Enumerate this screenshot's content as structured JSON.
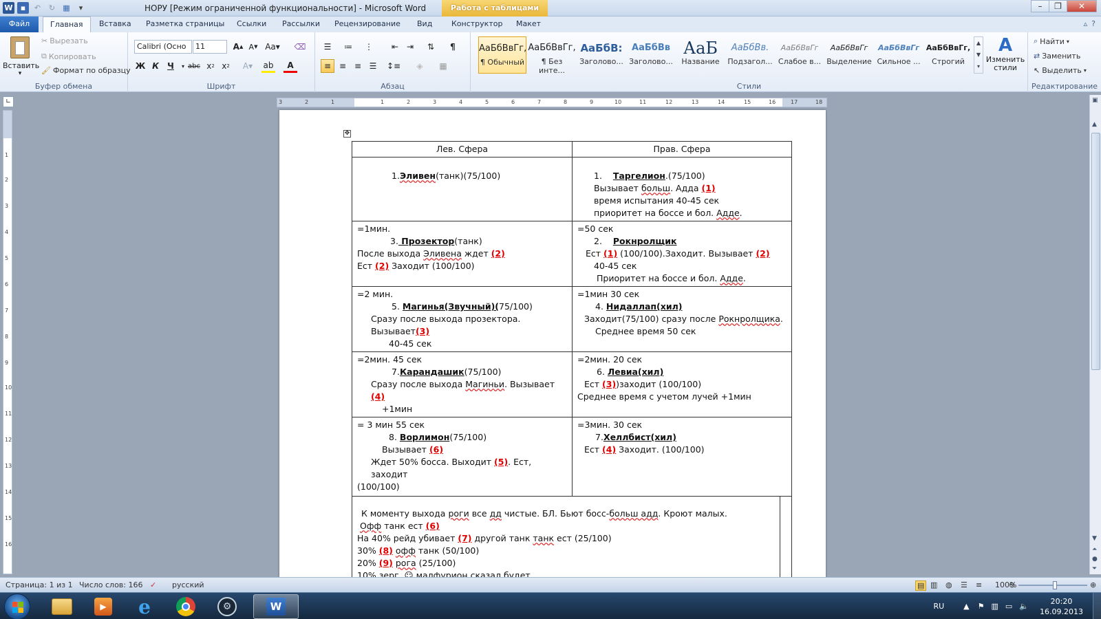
{
  "window": {
    "title": "НОРУ [Режим ограниченной функциональности]  -  Microsoft Word",
    "context_tab_header": "Работа с таблицами"
  },
  "tabs": [
    "Файл",
    "Главная",
    "Вставка",
    "Разметка страницы",
    "Ссылки",
    "Рассылки",
    "Рецензирование",
    "Вид",
    "Конструктор",
    "Макет"
  ],
  "ribbon": {
    "clipboard": {
      "label": "Буфер обмена",
      "paste": "Вставить",
      "cut": "Вырезать",
      "copy": "Копировать",
      "format_painter": "Формат по образцу"
    },
    "font": {
      "label": "Шрифт",
      "font_name": "Calibri (Осно",
      "font_size": "11"
    },
    "paragraph": {
      "label": "Абзац"
    },
    "styles": {
      "label": "Стили",
      "items": [
        {
          "sample": "АаБбВвГг,",
          "name": "¶ Обычный"
        },
        {
          "sample": "АаБбВвГг,",
          "name": "¶ Без инте..."
        },
        {
          "sample": "АаБбВ:",
          "name": "Заголово..."
        },
        {
          "sample": "АаБбВв",
          "name": "Заголово..."
        },
        {
          "sample": "АаБ",
          "name": "Название"
        },
        {
          "sample": "АаБбВв.",
          "name": "Подзагол..."
        },
        {
          "sample": "АаБбВвГг",
          "name": "Слабое в..."
        },
        {
          "sample": "АаБбВвГг",
          "name": "Выделение"
        },
        {
          "sample": "АаБбВвГг",
          "name": "Сильное ..."
        },
        {
          "sample": "АаБбВвГг,",
          "name": "Строгий"
        }
      ],
      "change_styles": "Изменить стили"
    },
    "editing": {
      "label": "Редактирование",
      "find": "Найти",
      "replace": "Заменить",
      "select": "Выделить"
    }
  },
  "ruler": {
    "h_marks": [
      "3",
      "2",
      "1",
      "1",
      "2",
      "3",
      "4",
      "5",
      "6",
      "7",
      "8",
      "9",
      "10",
      "11",
      "12",
      "13",
      "14",
      "15",
      "16",
      "17",
      "18"
    ],
    "v_marks": [
      "1",
      "2",
      "3",
      "4",
      "5",
      "6",
      "7",
      "8",
      "9",
      "10",
      "11",
      "12",
      "13",
      "14",
      "15",
      "16"
    ]
  },
  "document": {
    "headers": [
      "Лев. Сфера",
      "Прав. Сфера"
    ],
    "rows": {
      "r1": {
        "left": {
          "num": "1.",
          "name": "Эливен",
          "rest": "(танк)(75/100)"
        },
        "right": {
          "num": "1.",
          "name": "Таргелион",
          "rest": ".(75/100)",
          "l2a": "Вызывает ",
          "l2b": "больш",
          "l2c": ". Адда ",
          "l2ref": "(1)",
          "l3": "время испытания 40-45 сек",
          "l4a": "приоритет на боссе и бол. ",
          "l4b": "Адде",
          "l4c": "."
        }
      },
      "r2": {
        "left": {
          "time": "=1мин.",
          "num": "3.",
          "name": " Прозектор",
          "rest": "(танк)",
          "l3a": "После выхода ",
          "l3b": "Эливена",
          "l3c": " ждет ",
          "l3ref": "(2)",
          "l4a": "Ест ",
          "l4ref": "(2)",
          "l4b": " Заходит (100/100)"
        },
        "right": {
          "time": "=50 сек",
          "num": "2.",
          "name": "Рокнролщик",
          "l3a": "Ест ",
          "l3ref1": "(1)",
          "l3b": " (100/100).Заходит. Вызывает ",
          "l3ref2": "(2)",
          "l4": "40-45 сек",
          "l5a": "Приоритет на боссе и бол. ",
          "l5b": "Адде",
          "l5c": "."
        }
      },
      "r3": {
        "left": {
          "time": "=2 мин.",
          "num": "5.",
          "name": "Магинья(Звучный)(",
          "rest": "75/100)",
          "l3": "Сразу после выхода прозектора.",
          "l4a": "Вызывает",
          "l4ref": "(3)",
          "l5": "40-45 сек"
        },
        "right": {
          "time": "=1мин 30 сек",
          "num": "4.",
          "name": "Нидаллап(хил)",
          "l3a": "Заходит(75/100) сразу после ",
          "l3b": "Рокнролщика",
          "l3c": ".",
          "l4": "Среднее время 50 сек"
        }
      },
      "r4": {
        "left": {
          "time": "=2мин. 45 сек",
          "num": "7.",
          "name": "Карандашик",
          "rest": "(75/100)",
          "l3a": "Сразу после выхода ",
          "l3b": "Магиньи",
          "l3c": ". Вызывает ",
          "l3ref": "(4)",
          "l4": "+1мин"
        },
        "right": {
          "time": "=2мин. 20 сек",
          "num": "6.",
          "name": "Левиа(хил)",
          "l3a": "Ест ",
          "l3ref": "(3)",
          "l3b": ")заходит (100/100)",
          "l4": "Среднее время с учетом лучей +1мин"
        }
      },
      "r5": {
        "left": {
          "time": "= 3 мин 55 сек",
          "num": "8.",
          "name": "Ворлимон",
          "rest": "(75/100)",
          "l3a": "Вызывает ",
          "l3ref": "(6)",
          "l4a": "Ждет 50% босса. Выходит ",
          "l4ref": "(5)",
          "l4b": ". Ест, заходит",
          "l5": "(100/100)"
        },
        "right": {
          "time": "=3мин. 30 сек",
          "num": "7.",
          "name": "Хеллбист(хил)",
          "l3a": "Ест ",
          "l3ref": "(4)",
          "l3b": " Заходит. (100/100)"
        }
      },
      "r6": {
        "l1a": "К моменту выхода ",
        "l1b": "роги",
        "l1c": " все ",
        "l1d": "дд",
        "l1e": " чистые. БЛ. Бьют босс-",
        "l1f": "больш адд",
        "l1g": ". Кроют малых.",
        "l2a": "Офф",
        "l2b": " танк ест ",
        "l2ref": "(6)",
        "l3a": "На 40% рейд убивает ",
        "l3ref": "(7)",
        "l3b": " другой танк ",
        "l3c": "танк",
        "l3d": " ест (25/100)",
        "l4a": "30% ",
        "l4ref": "(8)",
        "l4b": " ",
        "l4c": "офф",
        "l4d": " танк (50/100)",
        "l5a": "20% ",
        "l5ref": "(9)",
        "l5b": " ",
        "l5c": "рога",
        "l5d": " (25/100)",
        "l6a": "10% ",
        "l6b": "зерг",
        "l6c": ". ☺ ",
        "l6d": "малфурион сказал",
        "l6e": " будет"
      }
    }
  },
  "status": {
    "page": "Страница: 1 из 1",
    "words": "Число слов: 166",
    "language": "русский",
    "zoom": "100%"
  },
  "taskbar": {
    "lang": "RU",
    "time": "20:20",
    "date": "16.09.2013"
  }
}
